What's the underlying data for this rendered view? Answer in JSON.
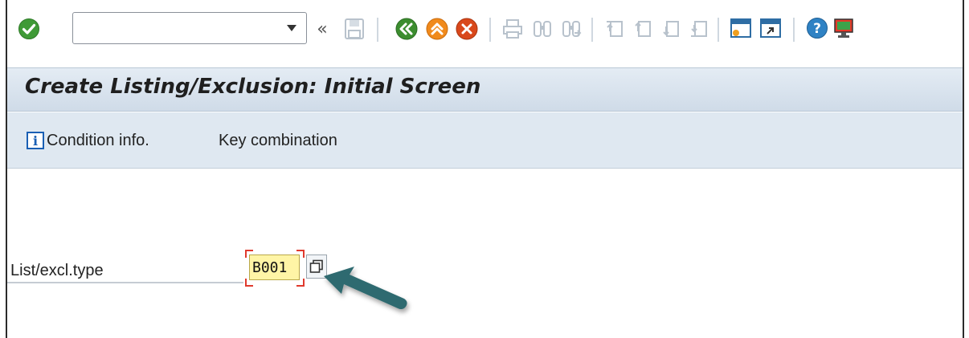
{
  "toolbar": {
    "command_field": {
      "value": "",
      "placeholder": ""
    },
    "icons": [
      "enter-icon",
      "command-dropdown-icon",
      "collapse-icon",
      "save-icon",
      "back-icon",
      "exit-icon",
      "cancel-icon",
      "print-icon",
      "find-icon",
      "find-next-icon",
      "first-page-icon",
      "previous-page-icon",
      "next-page-icon",
      "last-page-icon",
      "create-session-icon",
      "shortcut-icon",
      "help-icon",
      "customize-layout-icon"
    ],
    "collapse_glyph": "«"
  },
  "title": "Create Listing/Exclusion: Initial Screen",
  "app_toolbar": {
    "condition_info_label": "Condition info.",
    "key_combination_label": "Key combination",
    "info_icon_glyph": "i"
  },
  "form": {
    "list_excl_type_label": "List/excl.type",
    "list_excl_type_value": "B001"
  },
  "colors": {
    "title_bar": "#cfdbe8",
    "app_toolbar": "#dfe8f1",
    "input_highlight": "#fff5a6",
    "required_marker": "#e03a2e",
    "arrow": "#2f6b70"
  }
}
